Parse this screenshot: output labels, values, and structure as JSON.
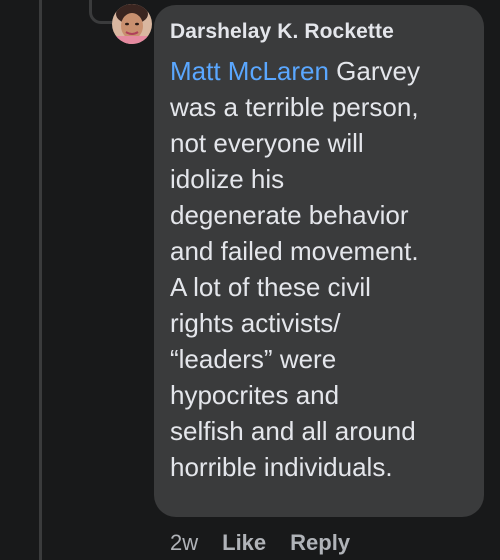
{
  "comment": {
    "author": "Darshelay K. Rockette",
    "mention": "Matt McLaren",
    "body": " Garvey\nwas a terrible person,\nnot everyone will\nidolize his\ndegenerate behavior\nand failed movement.\nA lot of these civil\nrights activists/\n“leaders” were\nhypocrites and\nselfish and all around\nhorrible individuals.",
    "timestamp": "2w",
    "like_label": "Like",
    "reply_label": "Reply"
  },
  "colors": {
    "background": "#18191a",
    "bubble": "#3a3b3c",
    "text": "#e4e6eb",
    "mention": "#5aa7ff",
    "meta": "#b0b3b8"
  }
}
